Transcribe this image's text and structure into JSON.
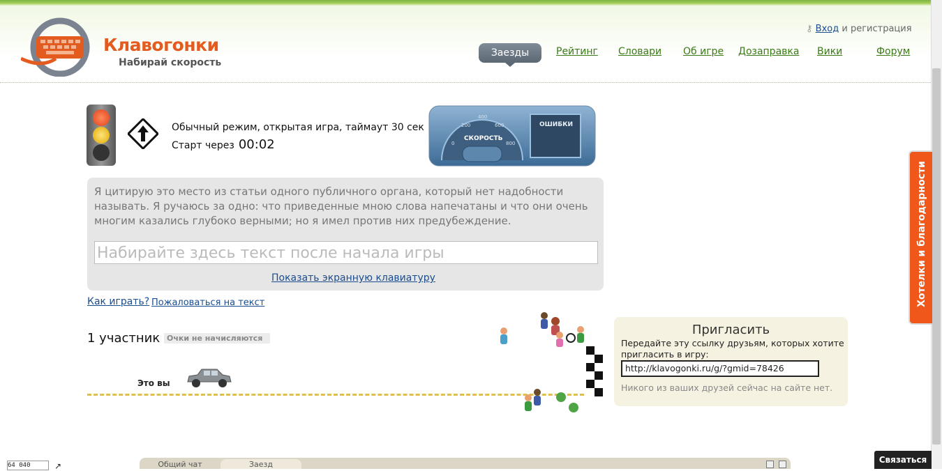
{
  "header": {
    "logo_title": "Клавогонки",
    "logo_sub": "Набирай скорость",
    "login_link": "Вход",
    "login_rest": "и регистрация"
  },
  "nav": {
    "items": [
      "Заезды",
      "Рейтинг",
      "Словари",
      "Об игре",
      "Дозаправка",
      "Вики",
      "Форум"
    ]
  },
  "game": {
    "status": "Обычный режим, открытая игра, таймаут 30 сек",
    "start_label": "Старт через",
    "countdown": "00:02",
    "dashboard_speed": "СКОРОСТЬ",
    "dashboard_errors": "ОШИБКИ",
    "quote": "Я цитирую это место из статьи одного публичного органа, который нет надобности называть. Я ручаюсь за одно: что приведенные мною слова напечатаны и что они очень многим казались глубоко верными; но я имел против них предубеждение.",
    "input_placeholder": "Набирайте здесь текст после начала игры",
    "show_keyboard": "Показать экранную клавиатуру",
    "how_to_play": "Как играть?",
    "complain": "Пожаловаться на текст"
  },
  "race": {
    "participants": "1 участник",
    "no_score": "Очки не начисляются",
    "you_label": "Это вы"
  },
  "invite": {
    "title": "Пригласить",
    "description": "Передайте эту ссылку друзьям, которых хотите пригласить в игру:",
    "link": "http://klavogonki.ru/g/?gmid=78426",
    "no_friends": "Никого из ваших друзей сейчас на сайте нет."
  },
  "side_tab": "Хотелки и благодарности",
  "bottom": {
    "counter": "64 040",
    "chat_tabs": [
      "Общий чат",
      "Заезд"
    ],
    "connect": "Связаться"
  },
  "colors": {
    "accent_orange": "#f0571b",
    "nav_green": "#3a7a16",
    "link_blue": "#1b4d8e"
  }
}
